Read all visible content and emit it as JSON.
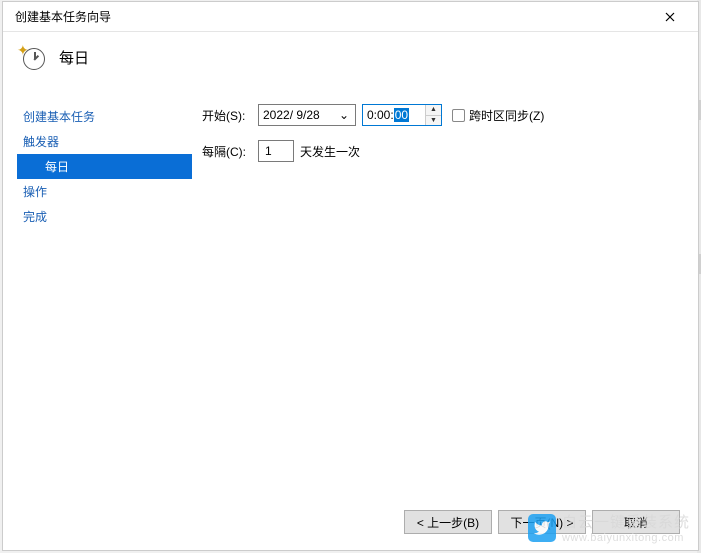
{
  "titlebar": {
    "text": "创建基本任务向导"
  },
  "header": {
    "title": "每日"
  },
  "sidebar": {
    "items": [
      {
        "label": "创建基本任务",
        "active": false,
        "sub": false
      },
      {
        "label": "触发器",
        "active": false,
        "sub": false
      },
      {
        "label": "每日",
        "active": true,
        "sub": true
      },
      {
        "label": "操作",
        "active": false,
        "sub": false
      },
      {
        "label": "完成",
        "active": false,
        "sub": false
      }
    ]
  },
  "form": {
    "start_label": "开始(S):",
    "date_value": "2022/ 9/28",
    "time_prefix": "0:00:",
    "time_selected": "00",
    "sync_label": "跨时区同步(Z)",
    "recur_label": "每隔(C):",
    "recur_value": "1",
    "recur_suffix": "天发生一次"
  },
  "footer": {
    "back_suffix": "步(B)",
    "next_prefix": "下一页(N)",
    "cancel": "取消"
  },
  "watermark": {
    "brand": "白云一键重装系统",
    "url": "www.baiyunxitong.com"
  }
}
